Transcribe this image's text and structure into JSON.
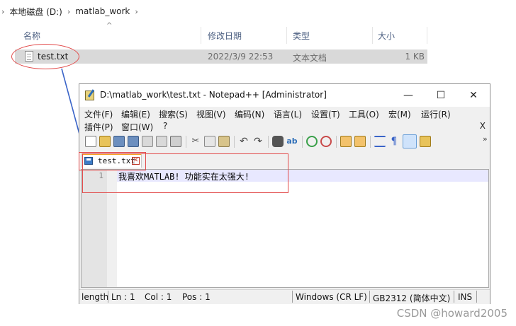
{
  "explorer": {
    "breadcrumb": [
      "本地磁盘 (D:)",
      "matlab_work"
    ],
    "columns": {
      "name": "名称",
      "date": "修改日期",
      "type": "类型",
      "size": "大小"
    },
    "file": {
      "name": "test.txt",
      "date": "2022/3/9 22:53",
      "type": "文本文档",
      "size": "1 KB",
      "icon": "text-file-icon"
    }
  },
  "npp": {
    "title": "D:\\matlab_work\\test.txt - Notepad++ [Administrator]",
    "window_buttons": {
      "minimize": "—",
      "maximize": "☐",
      "close": "✕"
    },
    "menu_row1": [
      "文件(F)",
      "编辑(E)",
      "搜索(S)",
      "视图(V)",
      "编码(N)",
      "语言(L)",
      "设置(T)",
      "工具(O)",
      "宏(M)",
      "运行(R)"
    ],
    "menu_row2": [
      "插件(P)",
      "窗口(W)",
      "?"
    ],
    "menu_close": "X",
    "toolbar_chevron": "»",
    "tab": {
      "label": "test.txt",
      "close": "✕"
    },
    "editor": {
      "line_number": "1",
      "text": "我喜欢MATLAB! 功能实在太强大!"
    },
    "status": {
      "length": "length",
      "ln": "Ln : 1",
      "col": "Col : 1",
      "pos": "Pos : 1",
      "eol": "Windows (CR LF)",
      "encoding": "GB2312 (简体中文)",
      "mode": "INS"
    }
  },
  "watermark": "CSDN @howard2005",
  "colors": {
    "highlight_red": "#e24a4a",
    "arrow_blue": "#3a64c8",
    "row_selected": "#d9d9d9"
  }
}
